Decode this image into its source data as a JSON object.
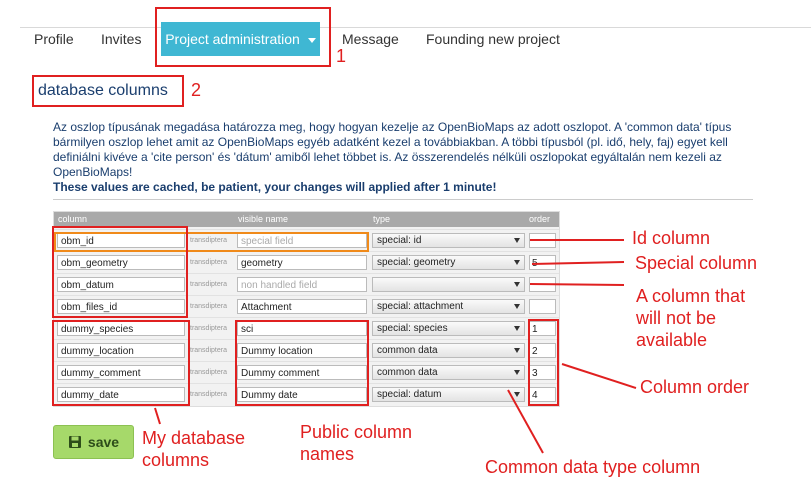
{
  "nav": {
    "items": [
      "Profile",
      "Invites",
      "Project administration",
      "Message",
      "Founding new project"
    ],
    "active": "Project administration"
  },
  "page_title": "database columns",
  "description": {
    "text": "Az oszlop típusának megadása határozza meg, hogy hogyan kezelje az OpenBioMaps az adott oszlopot. A 'common data' típus bármilyen oszlop lehet amit az OpenBioMaps egyéb adatként kezel a továbbiakban. A többi típusból (pl. idő, hely, faj) egyet kell definiálni kivéve a 'cite person' és 'dátum' amiből lehet többet is. Az összerendelés nélküli oszlopokat egyáltalán nem kezeli az OpenBioMaps!",
    "notice": "These values are cached, be patient, your changes will applied after 1 minute!"
  },
  "table": {
    "headers": [
      "column",
      "visible name",
      "type",
      "order"
    ],
    "translation_label": "transdiptera",
    "rows": [
      {
        "column": "obm_id",
        "visible_name": "",
        "visible_placeholder": "special field",
        "type": "special: id",
        "order": ""
      },
      {
        "column": "obm_geometry",
        "visible_name": "geometry",
        "visible_placeholder": "",
        "type": "special: geometry",
        "order": "5"
      },
      {
        "column": "obm_datum",
        "visible_name": "",
        "visible_placeholder": "non handled field",
        "type": "",
        "order": ""
      },
      {
        "column": "obm_files_id",
        "visible_name": "Attachment",
        "visible_placeholder": "",
        "type": "special: attachment",
        "order": ""
      },
      {
        "column": "dummy_species",
        "visible_name": "sci",
        "visible_placeholder": "",
        "type": "special: species",
        "order": "1"
      },
      {
        "column": "dummy_location",
        "visible_name": "Dummy location",
        "visible_placeholder": "",
        "type": "common data",
        "order": "2"
      },
      {
        "column": "dummy_comment",
        "visible_name": "Dummy comment",
        "visible_placeholder": "",
        "type": "common data",
        "order": "3"
      },
      {
        "column": "dummy_date",
        "visible_name": "Dummy date",
        "visible_placeholder": "",
        "type": "special: datum",
        "order": "4"
      }
    ]
  },
  "save_label": "save",
  "annotations": {
    "num1": "1",
    "num2": "2",
    "id_column": "Id column",
    "special_column": "Special column",
    "not_available": [
      "A column that",
      "will not be",
      "available"
    ],
    "column_order": "Column order",
    "my_db_columns": [
      "My database",
      "columns"
    ],
    "public_names": [
      "Public column",
      "names"
    ],
    "common_type": "Common data type column"
  },
  "colors": {
    "accent": "#3fb7d3",
    "annotation": "#e02020",
    "highlight": "#f08a1a",
    "save": "#a6d96a"
  }
}
